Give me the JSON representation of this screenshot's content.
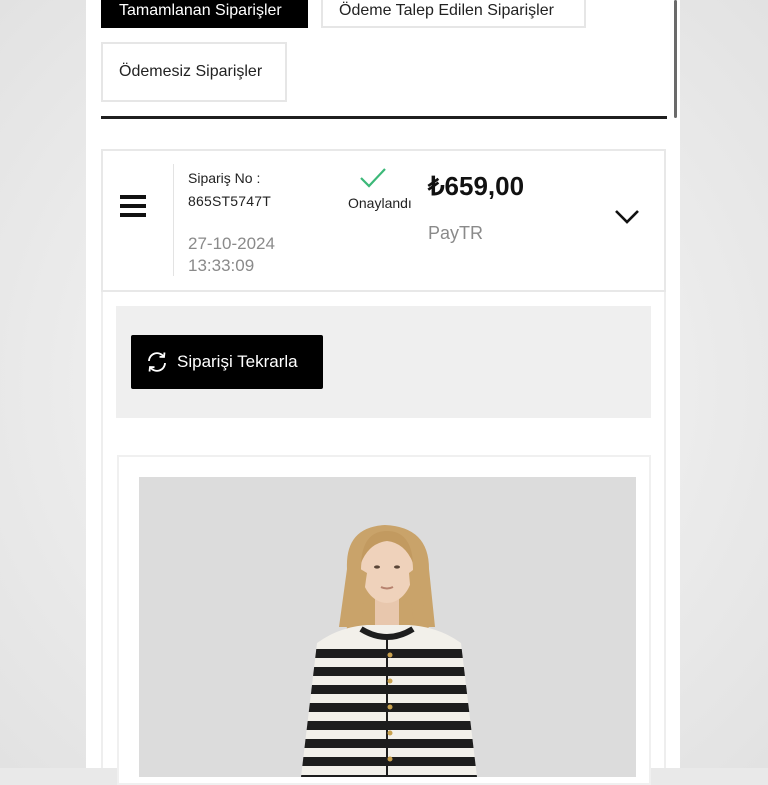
{
  "tabs": {
    "completed": "Tamamlanan Siparişler",
    "requested": "Ödeme Talep Edilen Siparişler",
    "unpaid": "Ödemesiz Siparişler"
  },
  "order": {
    "number_label": "Sipariş No :",
    "number": "865ST5747T",
    "date": "27-10-2024",
    "time": "13:33:09",
    "status": "Onaylandı",
    "price": "₺659,00",
    "payment_method": "PayTR"
  },
  "actions": {
    "repeat_label": "Siparişi Tekrarla"
  },
  "colors": {
    "accent": "#000000",
    "status_check": "#3cb878",
    "muted_text": "#8a8a8a"
  },
  "icons": {
    "menu": "hamburger-menu-icon",
    "status": "check-icon",
    "expand": "chevron-down-icon",
    "repeat": "refresh-icon"
  }
}
